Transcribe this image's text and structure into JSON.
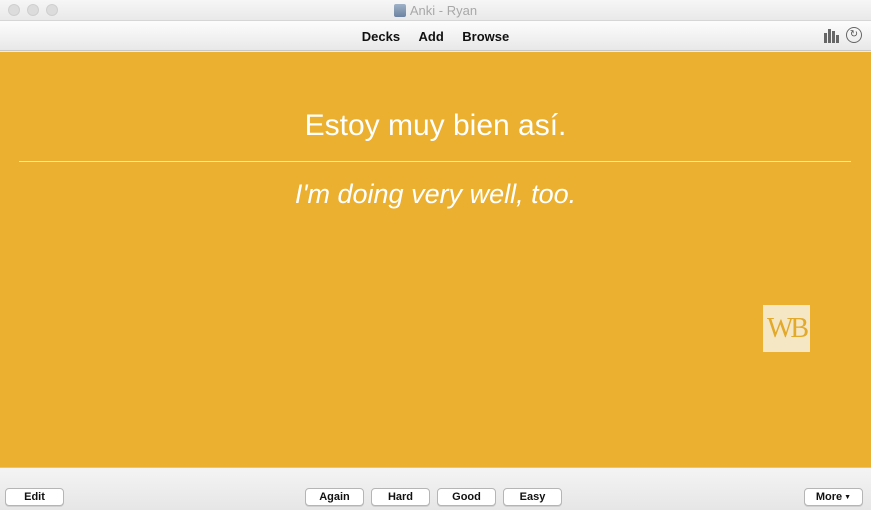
{
  "window": {
    "title": "Anki - Ryan"
  },
  "toolbar": {
    "decks": "Decks",
    "add": "Add",
    "browse": "Browse"
  },
  "card": {
    "front": "Estoy muy bien así.",
    "back": "I'm doing very well, too.",
    "logo_text": "WB",
    "background": "#ebb02f"
  },
  "bottom": {
    "edit": "Edit",
    "again": "Again",
    "hard": "Hard",
    "good": "Good",
    "easy": "Easy",
    "more": "More"
  }
}
